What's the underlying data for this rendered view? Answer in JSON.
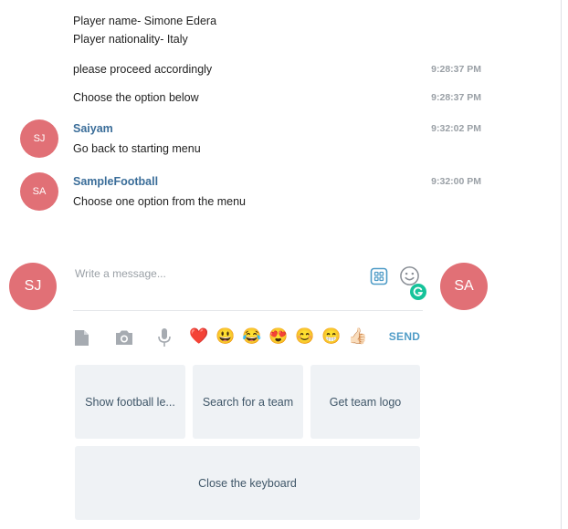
{
  "messages": {
    "player_name": "Player name- Simone Edera",
    "player_nationality": "Player nationality- Italy",
    "proceed": {
      "text": "please proceed accordingly",
      "time": "9:28:37 PM"
    },
    "choose": {
      "text": "Choose the option below",
      "time": "9:28:37 PM"
    },
    "saiyam": {
      "author": "Saiyam",
      "initials": "SJ",
      "text": "Go back to starting menu",
      "time": "9:32:02 PM"
    },
    "bot": {
      "author": "SampleFootball",
      "initials": "SA",
      "text": "Choose one option from the menu",
      "time": "9:32:00 PM"
    }
  },
  "composer": {
    "placeholder": "Write a message...",
    "user_initials": "SJ",
    "peer_initials": "SA",
    "send_label": "SEND"
  },
  "emojis": [
    "❤️",
    "😃",
    "😂",
    "😍",
    "😊",
    "😁",
    "👍🏻"
  ],
  "keyboard": {
    "row1": [
      "Show football le...",
      "Search for a team",
      "Get team logo"
    ],
    "row2": [
      "Close the keyboard"
    ]
  },
  "colors": {
    "avatar": "#e17076",
    "author": "#3a6d99",
    "send": "#4f9cc7",
    "keyboard_button": "#eff2f5",
    "keyboard_text": "#3f5668"
  }
}
